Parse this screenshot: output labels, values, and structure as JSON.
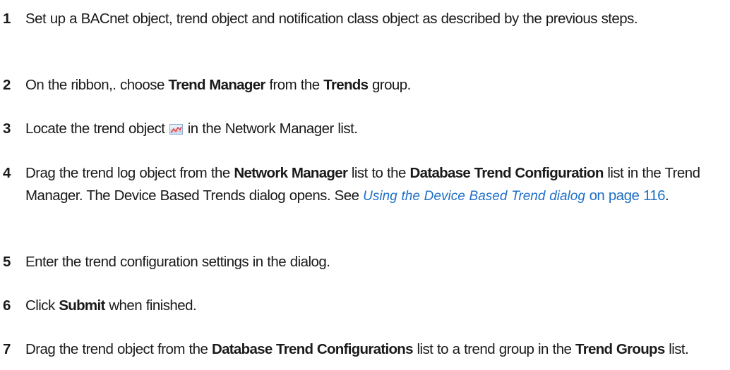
{
  "steps": [
    {
      "number": "1",
      "text": "Set up a BACnet object, trend object and notification class object as described by the previous steps."
    },
    {
      "number": "2",
      "pre": "On the ribbon,. choose ",
      "b1": "Trend Manager",
      "mid": " from the ",
      "b2": "Trends",
      "post": " group."
    },
    {
      "number": "3",
      "pre": "Locate the trend object ",
      "icon": "trend-chart-icon",
      "post": " in the Network Manager list."
    },
    {
      "number": "4",
      "pre": "Drag the trend log object from the ",
      "b1": "Network Manager",
      "mid": " list to the ",
      "b2": "Database Trend Configuration",
      "post": " list in the Trend Manager. The Device Based Trends dialog opens. See ",
      "link_text": "Using the Device Based Trend dialog",
      "link_page": " on page 116",
      "end": "."
    },
    {
      "number": "5",
      "text": "Enter the trend configuration settings in the dialog."
    },
    {
      "number": "6",
      "pre": "Click ",
      "b1": "Submit",
      "post": " when finished."
    },
    {
      "number": "7",
      "pre": "Drag the trend object from the ",
      "b1": "Database Trend Configurations",
      "mid": " list to a trend group in the ",
      "b2": "Trend Groups",
      "post": " list."
    }
  ],
  "colors": {
    "text": "#1a1a1a",
    "link": "#1f6fc7"
  }
}
